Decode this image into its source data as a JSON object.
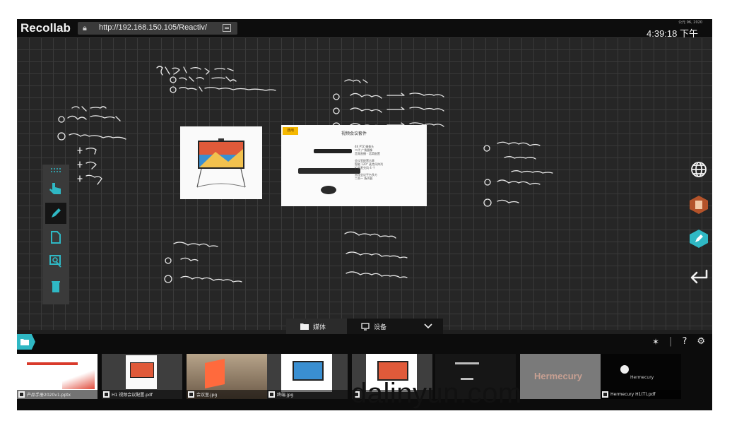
{
  "app": {
    "brand": "Recollab"
  },
  "url_bar": {
    "url": "http://192.168.150.105/Reactiv/"
  },
  "clock": {
    "date": "公元 96, 2020",
    "time": "4:39:18 下午"
  },
  "board": {
    "slide": {
      "tag": "通用",
      "title": "视频会议套件",
      "notes": [
        "4K PTZ 摄像头",
        "二代 广角摄像",
        "音频直播 · 话筒配置",
        "会议室配置示意",
        "智能 120° 麦克风阵列",
        "扩展麦克风 4 个",
        "直连会议平台多方",
        "二合一 扬声器"
      ]
    }
  },
  "dock_tabs": [
    {
      "label": "媒体",
      "icon": "folder-icon"
    },
    {
      "label": "设备",
      "icon": "monitor-icon"
    }
  ],
  "tray_tools": {
    "help": "?"
  },
  "tray_items": [
    {
      "caption": "产品手册2020v1.pptx",
      "type": "ppt"
    },
    {
      "caption": "H1 视频会议配置.pdf",
      "type": "pdf"
    },
    {
      "caption": "会议室.jpg",
      "type": "image"
    },
    {
      "caption": "终端.jpg",
      "type": "image"
    },
    {
      "caption": "",
      "type": "image"
    },
    {
      "caption": "",
      "type": "image"
    },
    {
      "caption": "",
      "type": "image"
    },
    {
      "caption": "Hermecury H1(T).pdf",
      "type": "pdf"
    }
  ],
  "tray_labels": {
    "hermecury": "Hermecury"
  },
  "watermark": "dalinyun.com",
  "colors": {
    "accent": "#2fb8c4",
    "background": "#1f1f1f",
    "canvas": "#262626",
    "grid": "#3a3a3a"
  }
}
